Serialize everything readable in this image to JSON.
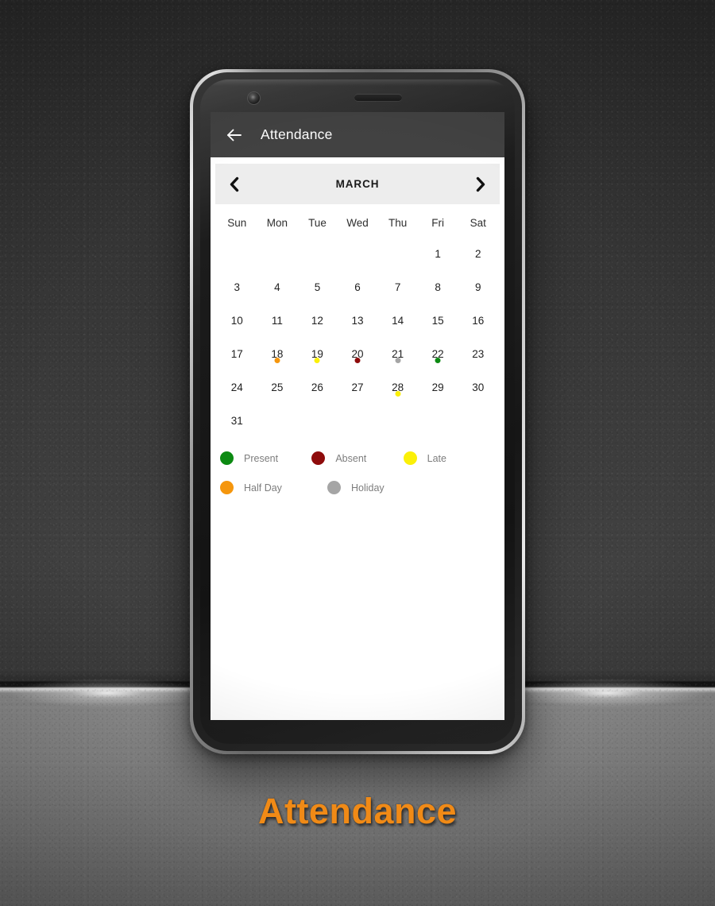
{
  "app": {
    "title": "Attendance",
    "back_icon": "arrow-left-icon",
    "appbar_color": "#424242"
  },
  "month_nav": {
    "prev_icon": "chevron-left-icon",
    "next_icon": "chevron-right-icon",
    "month_label": "MARCH",
    "bar_color": "#ededed"
  },
  "calendar": {
    "day_headers": [
      "Sun",
      "Mon",
      "Tue",
      "Wed",
      "Thu",
      "Fri",
      "Sat"
    ],
    "weeks": [
      [
        {
          "day": ""
        },
        {
          "day": ""
        },
        {
          "day": ""
        },
        {
          "day": ""
        },
        {
          "day": ""
        },
        {
          "day": "1"
        },
        {
          "day": "2"
        }
      ],
      [
        {
          "day": "3"
        },
        {
          "day": "4"
        },
        {
          "day": "5"
        },
        {
          "day": "6"
        },
        {
          "day": "7"
        },
        {
          "day": "8"
        },
        {
          "day": "9"
        }
      ],
      [
        {
          "day": "10"
        },
        {
          "day": "11"
        },
        {
          "day": "12"
        },
        {
          "day": "13"
        },
        {
          "day": "14"
        },
        {
          "day": "15"
        },
        {
          "day": "16"
        }
      ],
      [
        {
          "day": "17"
        },
        {
          "day": "18",
          "status": "half_day",
          "dot": "#f5960d"
        },
        {
          "day": "19",
          "status": "late",
          "dot": "#fbf008"
        },
        {
          "day": "20",
          "status": "absent",
          "dot": "#8e0b0b"
        },
        {
          "day": "21",
          "status": "holiday",
          "dot": "#a5a5a5"
        },
        {
          "day": "22",
          "status": "present",
          "dot": "#0c8a12"
        },
        {
          "day": "23"
        }
      ],
      [
        {
          "day": "24"
        },
        {
          "day": "25"
        },
        {
          "day": "26"
        },
        {
          "day": "27"
        },
        {
          "day": "28",
          "status": "late",
          "dot": "#fbf008"
        },
        {
          "day": "29"
        },
        {
          "day": "30"
        }
      ],
      [
        {
          "day": "31"
        },
        {
          "day": ""
        },
        {
          "day": ""
        },
        {
          "day": ""
        },
        {
          "day": ""
        },
        {
          "day": ""
        },
        {
          "day": ""
        }
      ]
    ]
  },
  "legend": {
    "rows": [
      [
        {
          "label": "Present",
          "color": "#0c8a12"
        },
        {
          "label": "Absent",
          "color": "#8e0b0b"
        },
        {
          "label": "Late",
          "color": "#fbf008"
        }
      ],
      [
        {
          "label": "Half Day",
          "color": "#f5960d"
        },
        {
          "label": "Holiday",
          "color": "#a5a5a5"
        }
      ]
    ]
  },
  "caption": {
    "text": "Attendance",
    "color": "#f08a16"
  }
}
